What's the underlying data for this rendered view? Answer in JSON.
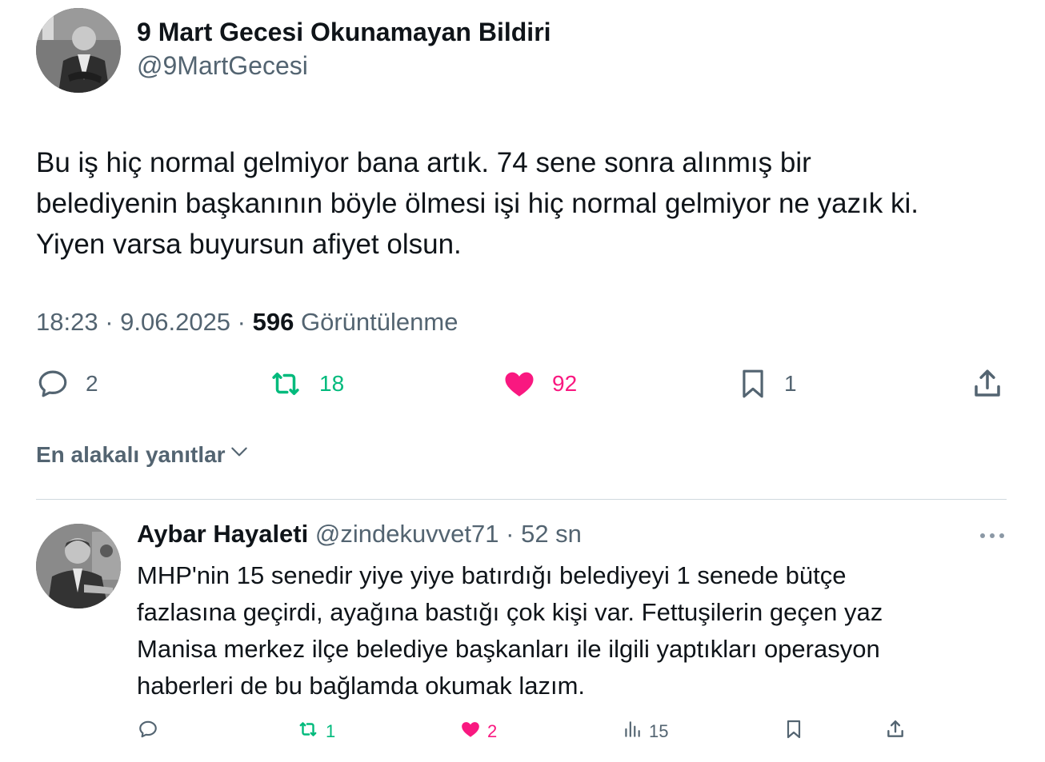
{
  "tweet": {
    "author": {
      "display_name": "9 Mart Gecesi Okunamayan Bildiri",
      "handle": "@9MartGecesi"
    },
    "text_lines": [
      "Bu iş hiç normal gelmiyor bana artık. 74 sene sonra alınmış bir",
      "belediyenin başkanının böyle ölmesi işi hiç normal gelmiyor ne yazık ki.",
      "Yiyen varsa buyursun afiyet olsun."
    ],
    "time": "18:23",
    "date": "9.06.2025",
    "views_count": "596",
    "views_label": "Görüntülenme",
    "stats": {
      "replies": "2",
      "retweets": "18",
      "likes": "92",
      "bookmarks": "1"
    }
  },
  "sort_label": "En alakalı yanıtlar",
  "reply": {
    "author": {
      "display_name": "Aybar Hayaleti",
      "handle": "@zindekuvvet71"
    },
    "time": "52 sn",
    "text_lines": [
      "MHP'nin 15 senedir yiye yiye batırdığı belediyeyi 1 senede bütçe",
      "fazlasına geçirdi, ayağına bastığı çok kişi var. Fettuşilerin geçen yaz",
      "Manisa merkez ilçe belediye başkanları ile ilgili yaptıkları operasyon",
      "haberleri de bu bağlamda okumak lazım."
    ],
    "stats": {
      "retweets": "1",
      "likes": "2",
      "views": "15"
    }
  },
  "colors": {
    "text": "#0f1419",
    "secondary": "#536471",
    "retweet": "#00ba7c",
    "like": "#f91880",
    "divider": "#cfd9de"
  },
  "icons": [
    "reply-icon",
    "retweet-icon",
    "heart-icon",
    "bookmark-icon",
    "share-icon",
    "chevron-down-icon",
    "more-icon",
    "views-icon"
  ]
}
